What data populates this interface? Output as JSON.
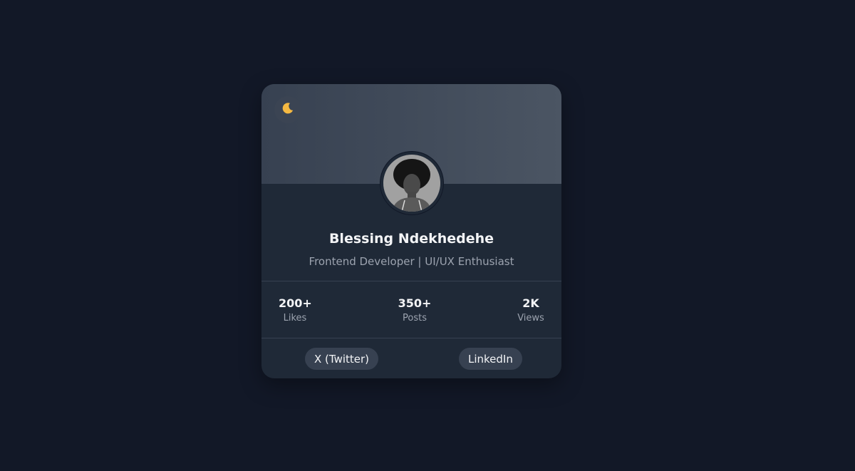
{
  "profile": {
    "name": "Blessing Ndekhedehe",
    "role": "Frontend Developer | UI/UX Enthusiast"
  },
  "theme_toggle": {
    "icon": "moon-icon",
    "color": "#f5b942"
  },
  "stats": [
    {
      "value": "200+",
      "label": "Likes"
    },
    {
      "value": "350+",
      "label": "Posts"
    },
    {
      "value": "2K",
      "label": "Views"
    }
  ],
  "social": {
    "twitter_label": "X (Twitter)",
    "linkedin_label": "LinkedIn"
  },
  "colors": {
    "page_bg": "#121827",
    "card_bg": "#1f2937",
    "banner_start": "#374151",
    "banner_end": "#4b5563",
    "text_primary": "#f3f4f6",
    "text_secondary": "#9ca3af"
  }
}
